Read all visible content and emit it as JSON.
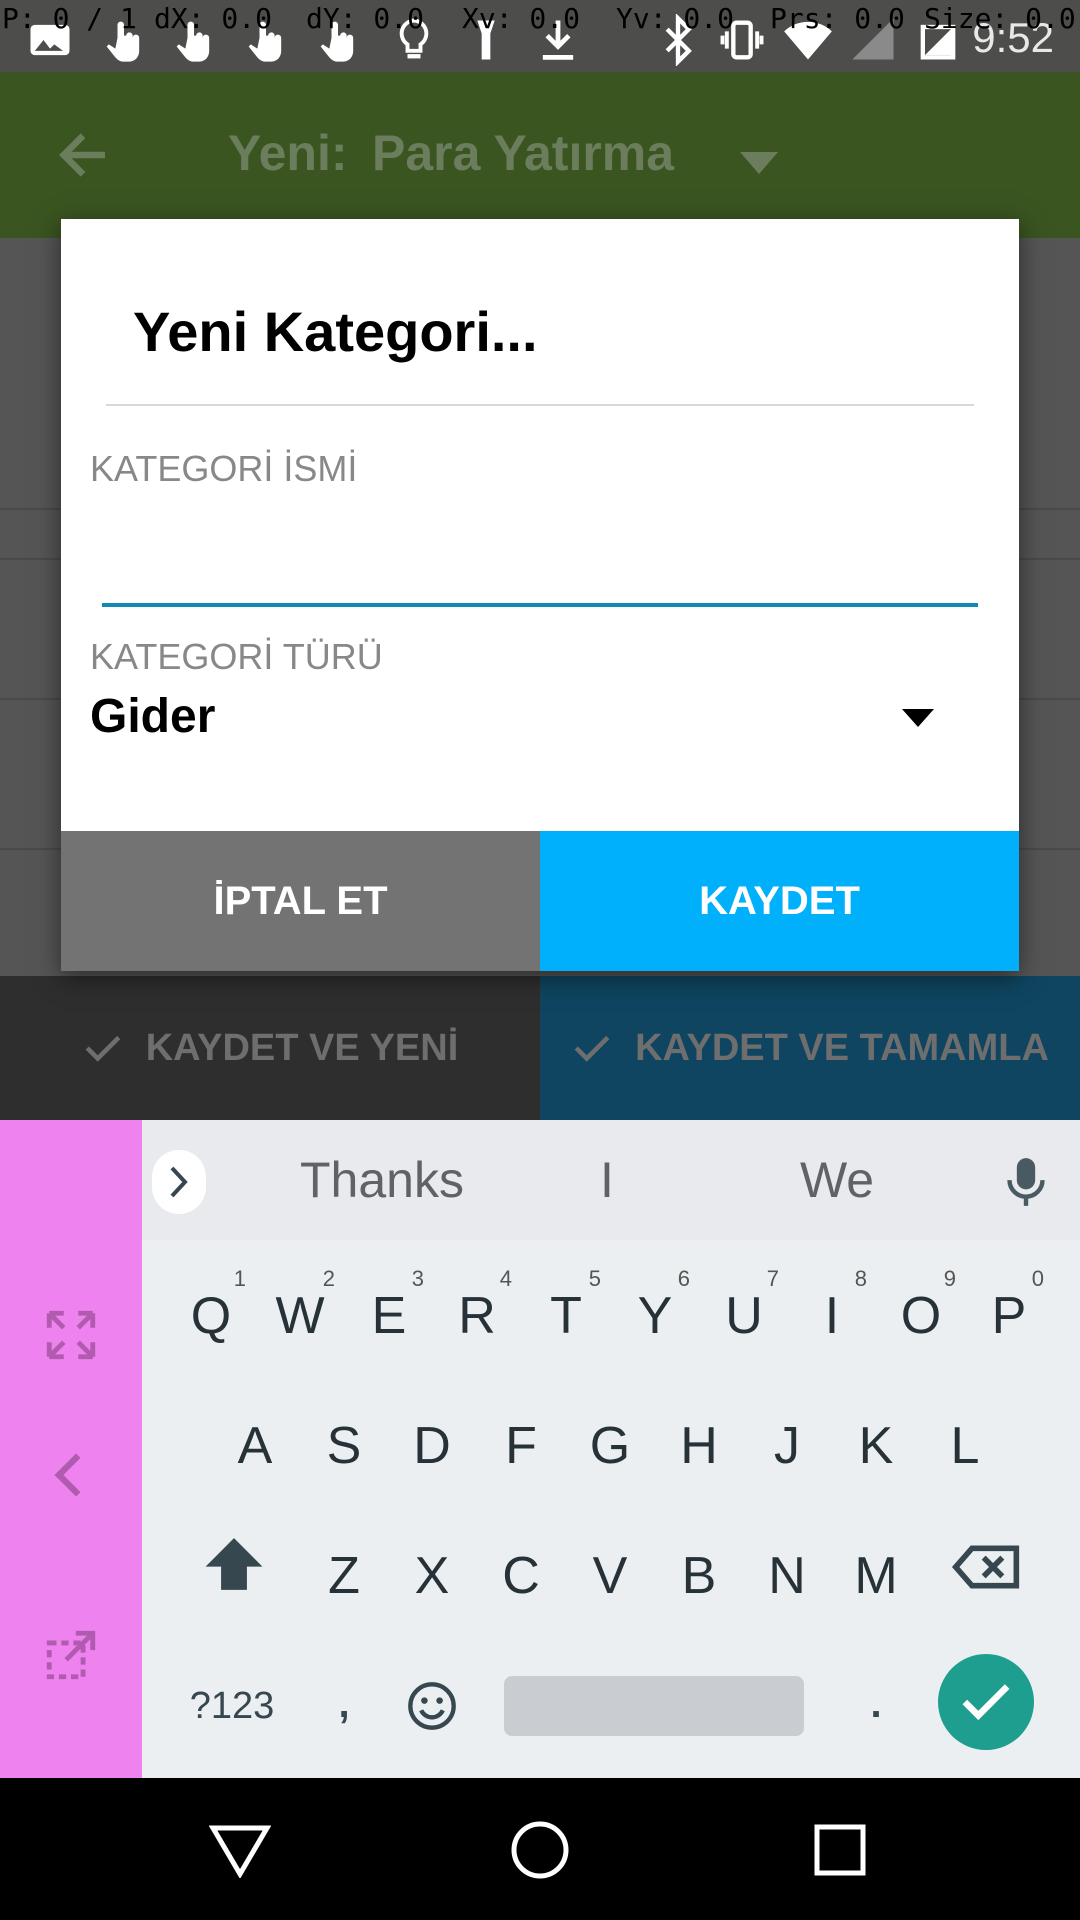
{
  "status_bar": {
    "pointer_info": [
      "P: 0 / 1",
      "dX: 0.0",
      "dY: 0.0",
      "Xv: 0.0",
      "Yv: 0.0",
      "Prs: 0.0",
      "Size: 0.0"
    ],
    "time": "9:52"
  },
  "app_bar": {
    "title_prefix": "Yeni:",
    "title_type": "Para Yatırma"
  },
  "dialog": {
    "title": "Yeni Kategori...",
    "name_label": "KATEGORİ İSMİ",
    "name_value": "",
    "type_label": "KATEGORİ TÜRÜ",
    "type_value": "Gider",
    "cancel_label": "İPTAL ET",
    "save_label": "KAYDET"
  },
  "action_bar": {
    "save_new_label": "KAYDET VE YENİ",
    "save_complete_label": "KAYDET VE TAMAMLA"
  },
  "keyboard": {
    "suggestions": [
      "Thanks",
      "I",
      "We"
    ],
    "row1": [
      "Q",
      "W",
      "E",
      "R",
      "T",
      "Y",
      "U",
      "I",
      "O",
      "P"
    ],
    "row1_hints": [
      "1",
      "2",
      "3",
      "4",
      "5",
      "6",
      "7",
      "8",
      "9",
      "0"
    ],
    "row2": [
      "A",
      "S",
      "D",
      "F",
      "G",
      "H",
      "J",
      "K",
      "L"
    ],
    "row3": [
      "Z",
      "X",
      "C",
      "V",
      "B",
      "N",
      "M"
    ],
    "symbols_label": "?123",
    "comma": ",",
    "period": "."
  },
  "colors": {
    "app_bar": "#3a5520",
    "save_button": "#00b0fb",
    "cancel_button": "#737373",
    "input_underline": "#1289b4",
    "keyboard_side_panel": "#ee82ee",
    "enter_key": "#1d9e8f"
  },
  "icons": {
    "status": [
      "gallery-icon",
      "touch-icon",
      "touch-icon",
      "touch-icon",
      "touch-icon",
      "lightbulb-icon",
      "flashlight-icon",
      "download-icon",
      "bluetooth-icon",
      "vibrate-icon",
      "wifi-icon",
      "signal-icon",
      "battery-icon"
    ],
    "nav": [
      "back-triangle-icon",
      "home-circle-icon",
      "recents-square-icon"
    ]
  }
}
